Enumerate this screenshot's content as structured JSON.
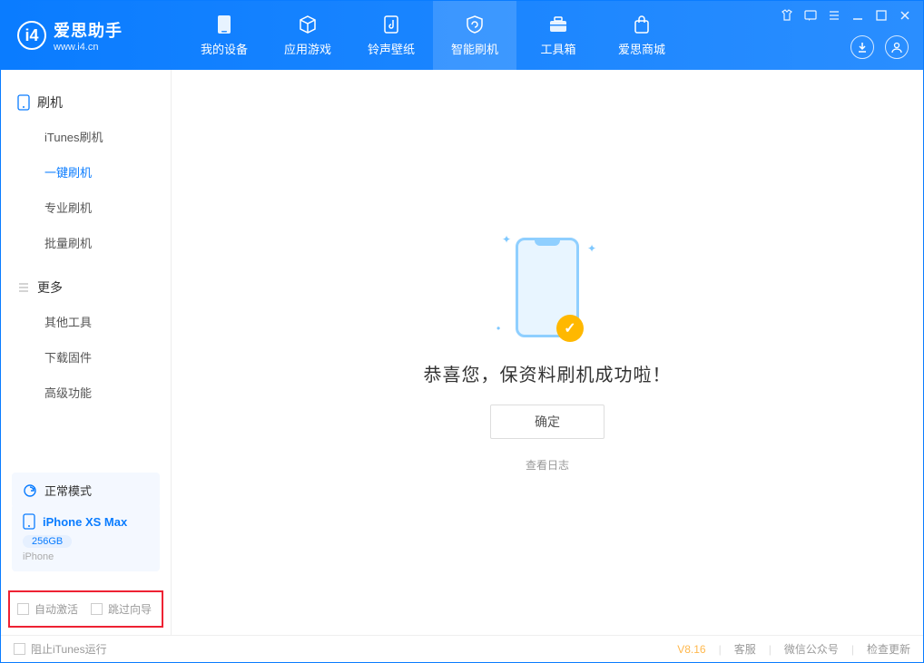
{
  "app": {
    "title": "爱思助手",
    "url": "www.i4.cn"
  },
  "tabs": [
    {
      "label": "我的设备"
    },
    {
      "label": "应用游戏"
    },
    {
      "label": "铃声壁纸"
    },
    {
      "label": "智能刷机"
    },
    {
      "label": "工具箱"
    },
    {
      "label": "爱思商城"
    }
  ],
  "sidebar": {
    "section1": {
      "title": "刷机"
    },
    "items1": [
      {
        "label": "iTunes刷机"
      },
      {
        "label": "一键刷机"
      },
      {
        "label": "专业刷机"
      },
      {
        "label": "批量刷机"
      }
    ],
    "section2": {
      "title": "更多"
    },
    "items2": [
      {
        "label": "其他工具"
      },
      {
        "label": "下载固件"
      },
      {
        "label": "高级功能"
      }
    ],
    "mode": {
      "label": "正常模式"
    },
    "device": {
      "name": "iPhone XS Max",
      "capacity": "256GB",
      "type": "iPhone"
    },
    "checks": {
      "auto_activate": "自动激活",
      "skip_guide": "跳过向导"
    }
  },
  "main": {
    "success_text": "恭喜您，保资料刷机成功啦！",
    "ok_label": "确定",
    "view_log": "查看日志"
  },
  "footer": {
    "block_itunes": "阻止iTunes运行",
    "version": "V8.16",
    "links": [
      {
        "label": "客服"
      },
      {
        "label": "微信公众号"
      },
      {
        "label": "检查更新"
      }
    ]
  }
}
